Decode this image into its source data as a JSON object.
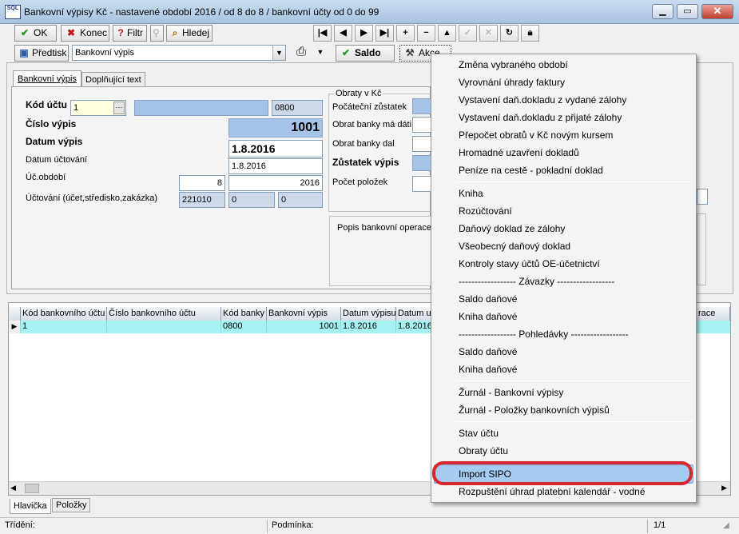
{
  "window": {
    "title": "Bankovní výpisy Kč - nastavené období 2016 / od 8 do 8 / bankovní účty od 0 do 99",
    "icon_text": "SQL"
  },
  "toolbar": {
    "ok": "OK",
    "konec": "Konec",
    "filtr": "Filtr",
    "hledej": "Hledej",
    "predtisk": "Předtisk",
    "report": "Bankovní výpis",
    "saldo": "Saldo",
    "akce": "Akce"
  },
  "tabs": {
    "main": "Bankovní výpis",
    "extra": "Doplňující text"
  },
  "form": {
    "kod_uctu_label": "Kód účtu",
    "kod_uctu_value": "1",
    "kod_banky_value": "0800",
    "cislo_vypis_label": "Číslo výpis",
    "cislo_vypis_value": "1001",
    "datum_vypis_label": "Datum výpis",
    "datum_vypis_value": "1.8.2016",
    "datum_uctovani_label": "Datum účtování",
    "datum_uctovani_value": "1.8.2016",
    "uc_obdobi_label": "Úč.období",
    "uc_obdobi_month": "8",
    "uc_obdobi_year": "2016",
    "uctovani_label": "Účtování (účet,středisko,zakázka)",
    "ucet_value": "221010",
    "stredisko_value": "0",
    "zakazka_value": "0"
  },
  "obraty": {
    "group_label": "Obraty v Kč",
    "pocatecni": "Počáteční zůstatek",
    "obrat_ma_dati": "Obrat banky má dáti",
    "obrat_dal": "Obrat banky dal",
    "zustatek": "Zůstatek výpis",
    "pocet": "Počet položek"
  },
  "popis_label": "Popis bankovní operace",
  "grid": {
    "columns": [
      "Kód bankovního účtu",
      "Číslo bankovního účtu",
      "Kód banky",
      "Bankovní výpis",
      "Datum výpisu",
      "Datum u",
      "race"
    ],
    "row": [
      "1",
      "",
      "0800",
      "1001",
      "1.8.2016",
      "1.8.2016"
    ]
  },
  "bottom_tabs": [
    "Hlavička",
    "Položky"
  ],
  "status": {
    "trideni": "Třídění:",
    "podminka": "Podmínka:",
    "page": "1/1"
  },
  "menu": {
    "items": [
      "Změna vybraného období",
      "Vyrovnání úhrady faktury",
      "Vystavení daň.dokladu z vydané zálohy",
      "Vystavení daň.dokladu z přijaté zálohy",
      "Přepočet obratů v Kč novým kursem",
      "Hromadné uzavření dokladů",
      "Peníze na cestě - pokladní doklad",
      "Kniha",
      "Rozúčtování",
      "Daňový doklad ze zálohy",
      "Všeobecný daňový doklad",
      "Kontroly stavy účtů OE-účetnictví",
      "------------------ Závazky ------------------",
      "Saldo daňové",
      "Kniha daňové",
      "------------------ Pohledávky ------------------",
      "Saldo daňové",
      "Kniha daňové",
      "Žurnál - Bankovní výpisy",
      "Žurnál - Položky bankovních výpisů",
      "Stav účtu",
      "Obraty účtu",
      "Import SIPO",
      "Rozpuštění úhrad platební kalendář - vodné"
    ]
  },
  "colors": {
    "highlight": "#a6cbf0",
    "annotation": "#d9262e",
    "grid_row": "#a6f2f2"
  }
}
